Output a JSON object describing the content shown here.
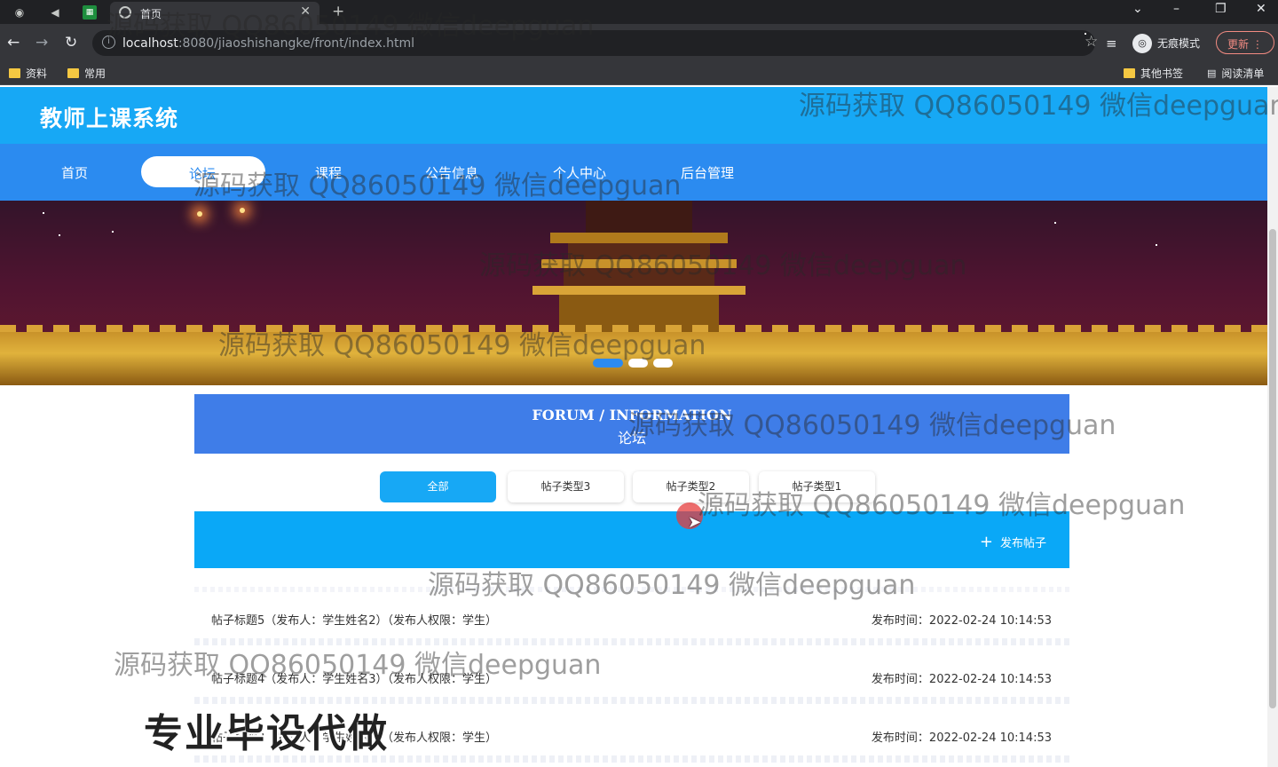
{
  "browser": {
    "tab_title": "首页",
    "url_host": "localhost",
    "url_rest": ":8080/jiaoshishangke/front/index.html",
    "incognito_label": "无痕模式",
    "update_label": "更新",
    "bookmarks": [
      "资料",
      "常用"
    ],
    "bookmarks_right": [
      "其他书签",
      "阅读清单"
    ]
  },
  "site": {
    "title": "教师上课系统",
    "nav": [
      "首页",
      "论坛",
      "课程",
      "公告信息",
      "个人中心",
      "后台管理"
    ],
    "active_nav": "论坛"
  },
  "banner": {
    "slides": 3,
    "active_slide": 1
  },
  "forum": {
    "title_en": "FORUM / INFORMATION",
    "title_cn": "论坛",
    "filters": [
      "全部",
      "帖子类型3",
      "帖子类型2",
      "帖子类型1"
    ],
    "active_filter": "全部",
    "post_button": "发布帖子",
    "posts": [
      {
        "title": "帖子标题5（发布人：学生姓名2）（发布人权限：学生）",
        "time": "发布时间：2022-02-24 10:14:53"
      },
      {
        "title": "帖子标题4（发布人：学生姓名3）（发布人权限：学生）",
        "time": "发布时间：2022-02-24 10:14:53"
      },
      {
        "title": "帖子标题3（发布人：学生姓名1）（发布人权限：学生）",
        "time": "发布时间：2022-02-24 10:14:53"
      }
    ]
  },
  "watermark": "源码获取 QQ86050149 微信deepguan",
  "promo": "专业毕设代做",
  "colors": {
    "header": "#17a8f5",
    "nav": "#2b8bf0",
    "forum_head": "#3f7de8",
    "post_bar": "#0aa8f7"
  }
}
